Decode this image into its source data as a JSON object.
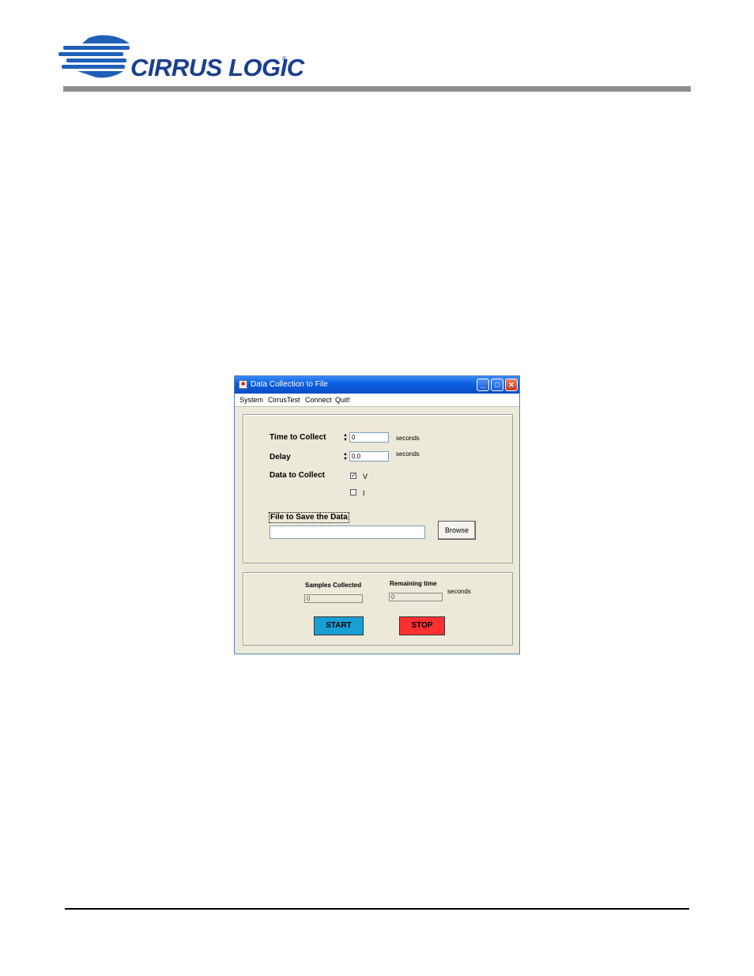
{
  "header": {
    "brand_name": "CIRRUS LOGIC",
    "registered_mark": "®",
    "colors": {
      "logo_blue": "#1a3f8f",
      "bar_gray": "#8c8c8c"
    }
  },
  "window": {
    "title": "Data Collection to File",
    "title_icon_name": "app-icon",
    "controls": {
      "minimize": "_",
      "maximize": "□",
      "close": "✕"
    },
    "menu": [
      "System",
      "CirrusTest",
      "Connect",
      "Quit!"
    ]
  },
  "collect_group": {
    "time_label": "Time to Collect",
    "time_value": "0",
    "time_unit": "seconds",
    "delay_label": "Delay",
    "delay_value": "0.0",
    "delay_unit": "seconds",
    "data_label": "Data to Collect",
    "options": [
      {
        "label": "V",
        "checked": true
      },
      {
        "label": "I",
        "checked": false
      }
    ],
    "file_label": "File to Save the Data",
    "file_value": "",
    "browse_label": "Browse"
  },
  "status_group": {
    "samples_label": "Samples Collected",
    "samples_value": "0",
    "remaining_label": "Remaining time",
    "remaining_value": "0",
    "remaining_unit": "seconds",
    "start_label": "START",
    "stop_label": "STOP",
    "colors": {
      "start": "#1a9fd4",
      "stop": "#ff3030"
    }
  }
}
